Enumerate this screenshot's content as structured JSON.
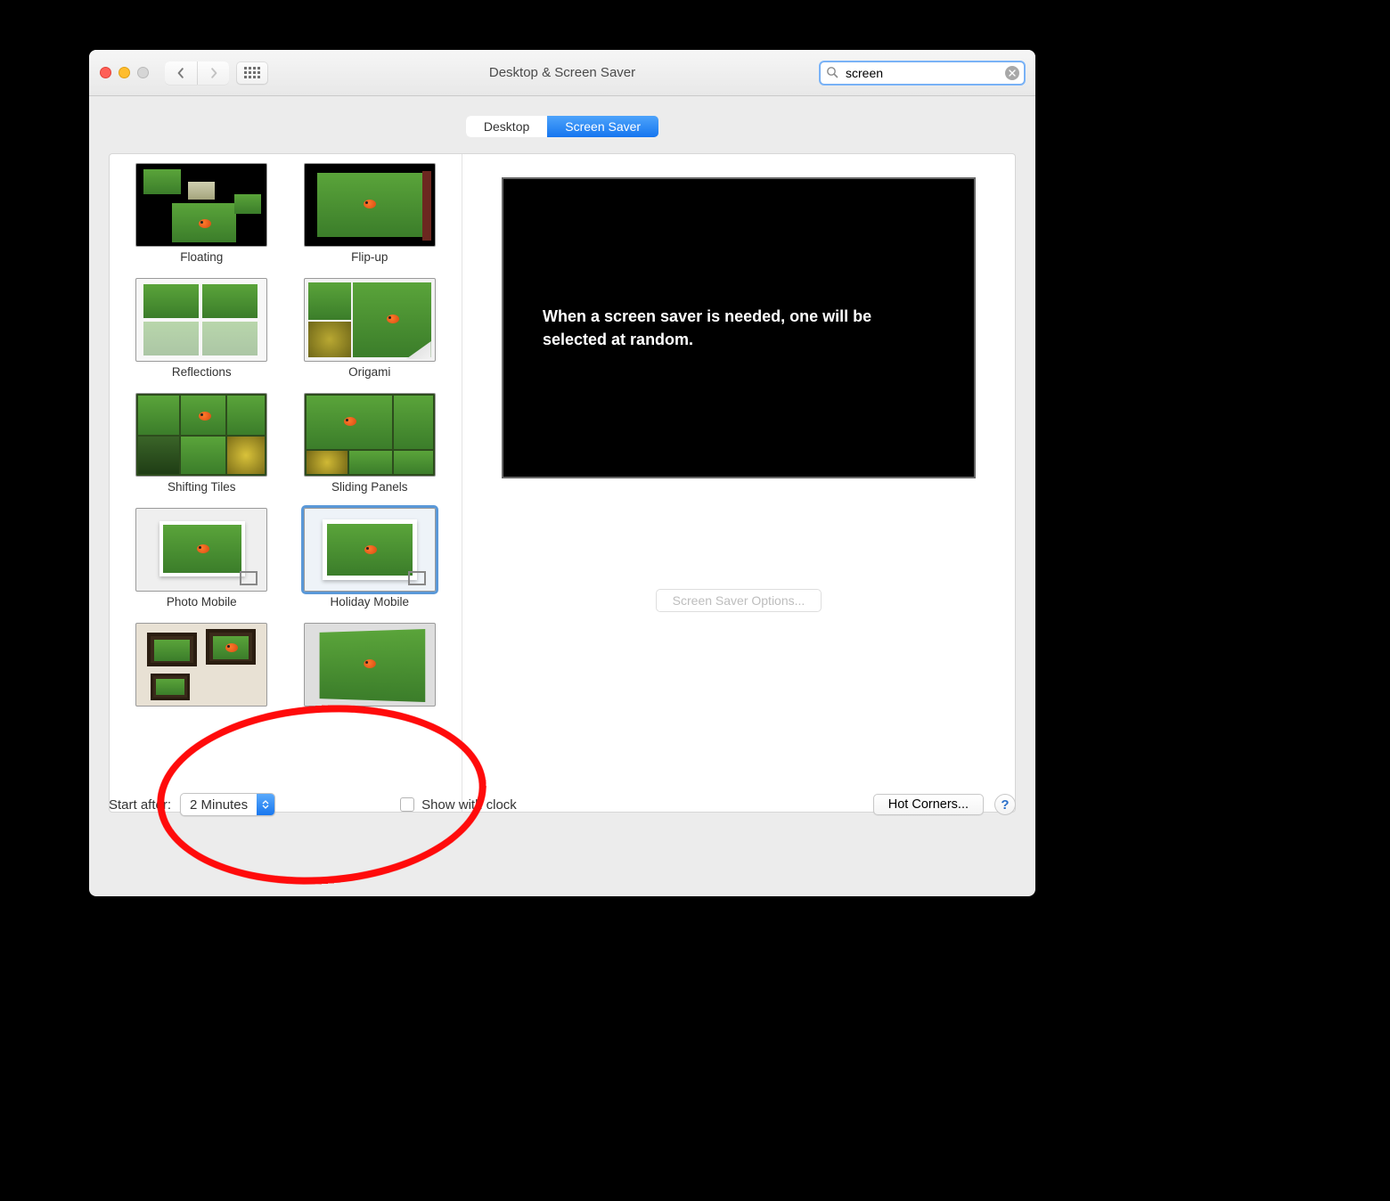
{
  "window": {
    "title": "Desktop & Screen Saver"
  },
  "search": {
    "value": "screen"
  },
  "tabs": {
    "desktop": "Desktop",
    "screensaver": "Screen Saver"
  },
  "savers": [
    {
      "label": "Floating"
    },
    {
      "label": "Flip-up"
    },
    {
      "label": "Reflections"
    },
    {
      "label": "Origami"
    },
    {
      "label": "Shifting Tiles"
    },
    {
      "label": "Sliding Panels"
    },
    {
      "label": "Photo Mobile"
    },
    {
      "label": "Holiday Mobile"
    }
  ],
  "preview": {
    "message": "When a screen saver is needed, one will be selected at random."
  },
  "buttons": {
    "options": "Screen Saver Options...",
    "hot_corners": "Hot Corners..."
  },
  "footer": {
    "start_after_label": "Start after:",
    "start_after_value": "2 Minutes",
    "show_clock": "Show with clock"
  },
  "help": "?"
}
